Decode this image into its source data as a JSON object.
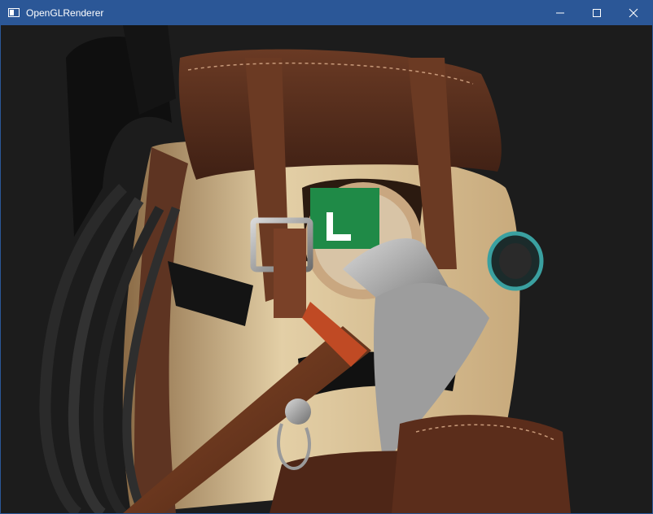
{
  "window": {
    "title": "OpenGLRenderer",
    "controls": {
      "minimize": "minimize-icon",
      "maximize": "maximize-icon",
      "close": "close-icon"
    },
    "titlebar_color": "#2b5797"
  },
  "viewport": {
    "background": "#1c1c1c",
    "scene_subject": "backpack-model-icon"
  }
}
